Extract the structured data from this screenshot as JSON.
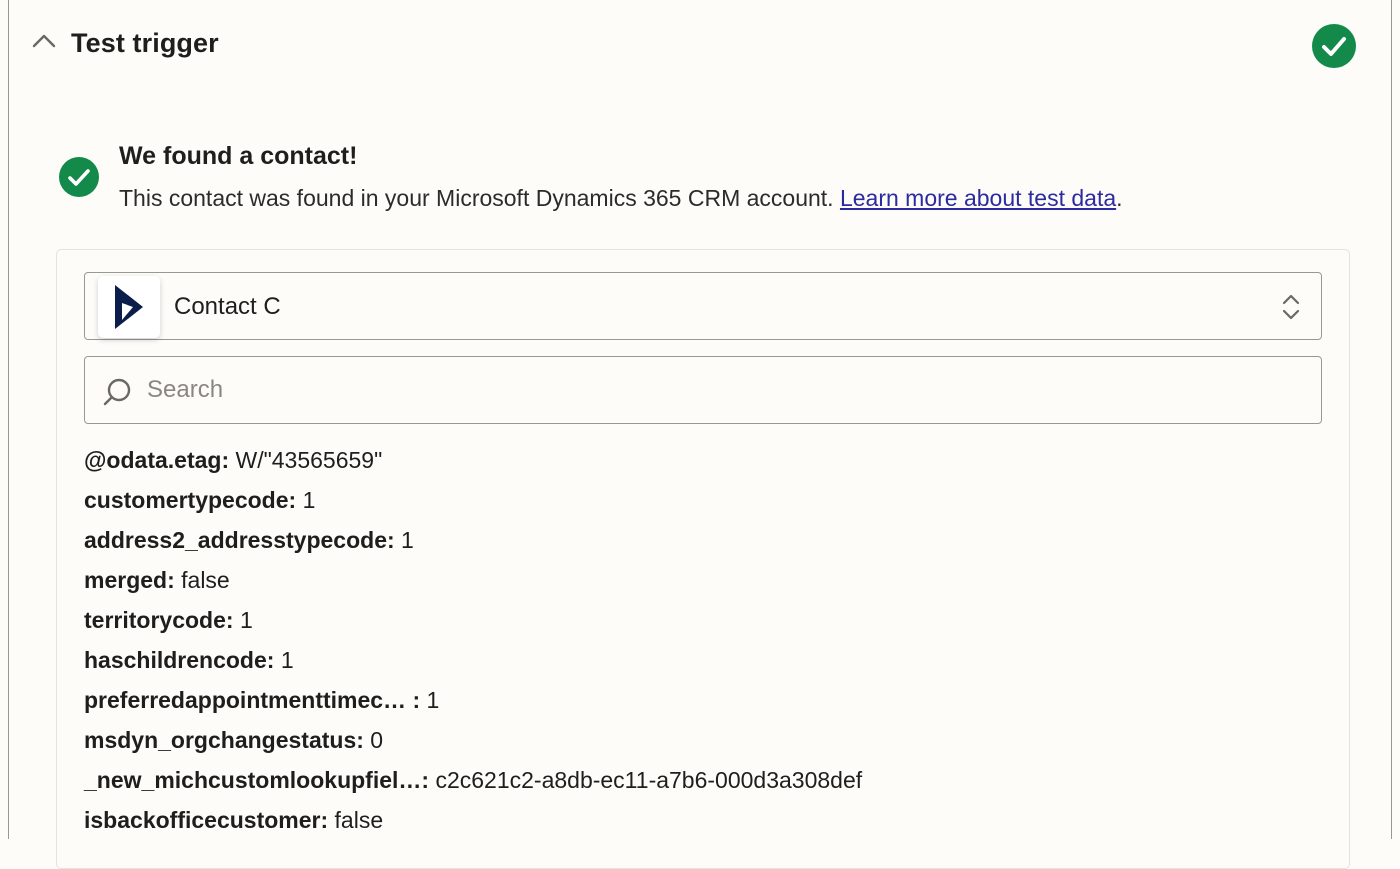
{
  "section": {
    "title": "Test trigger",
    "status_icon": "check-circle-icon",
    "status_color": "#138a4a"
  },
  "result": {
    "title": "We found a contact!",
    "description": "This contact was found in your Microsoft Dynamics 365 CRM account.",
    "link_text": "Learn more about test data",
    "trailing": "."
  },
  "record_select": {
    "app_icon": "microsoft-dynamics-logo",
    "selected": "Contact C"
  },
  "search": {
    "placeholder": "Search"
  },
  "fields": [
    {
      "key": "@odata.etag:",
      "value": "W/\"43565659\""
    },
    {
      "key": "customertypecode:",
      "value": "1"
    },
    {
      "key": "address2_addresstypecode:",
      "value": "1"
    },
    {
      "key": "merged:",
      "value": "false"
    },
    {
      "key": "territorycode:",
      "value": "1"
    },
    {
      "key": "haschildrencode:",
      "value": "1"
    },
    {
      "key": "preferredappointmenttimec…  :",
      "value": "1"
    },
    {
      "key": "msdyn_orgchangestatus:",
      "value": "0"
    },
    {
      "key": "_new_michcustomlookupfiel…:",
      "value": "c2c621c2-a8db-ec11-a7b6-000d3a308def"
    },
    {
      "key": "isbackofficecustomer:",
      "value": "false"
    }
  ],
  "colors": {
    "accent_green": "#138a4a",
    "link": "#2b2aa0",
    "background": "#fdfcf9"
  }
}
